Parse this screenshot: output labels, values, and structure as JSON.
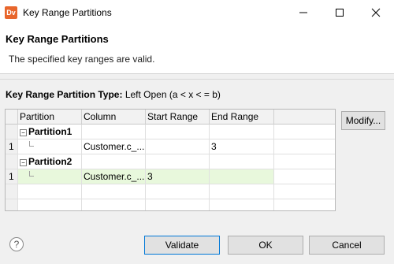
{
  "window": {
    "app_icon_text": "Dv",
    "title": "Key Range Partitions"
  },
  "banner": {
    "title": "Key Range Partitions",
    "message": "The specified key ranges are valid."
  },
  "partition_type": {
    "label": "Key Range Partition Type:",
    "value": "Left Open (a < x < = b)"
  },
  "grid": {
    "headers": [
      "",
      "Partition",
      "Column",
      "Start Range",
      "End Range",
      ""
    ],
    "rows": [
      {
        "type": "group",
        "partition": "Partition1"
      },
      {
        "type": "data",
        "num": "1",
        "column": "Customer.c_...",
        "start": "",
        "end": "3"
      },
      {
        "type": "group",
        "partition": "Partition2"
      },
      {
        "type": "data",
        "num": "1",
        "column": "Customer.c_...",
        "start": "3",
        "end": ""
      }
    ]
  },
  "buttons": {
    "modify": "Modify...",
    "validate": "Validate",
    "ok": "OK",
    "cancel": "Cancel"
  },
  "help_glyph": "?",
  "colors": {
    "selected_row": "#e8f8dc",
    "app_icon": "#e8662c",
    "default_button_border": "#0078d7"
  }
}
